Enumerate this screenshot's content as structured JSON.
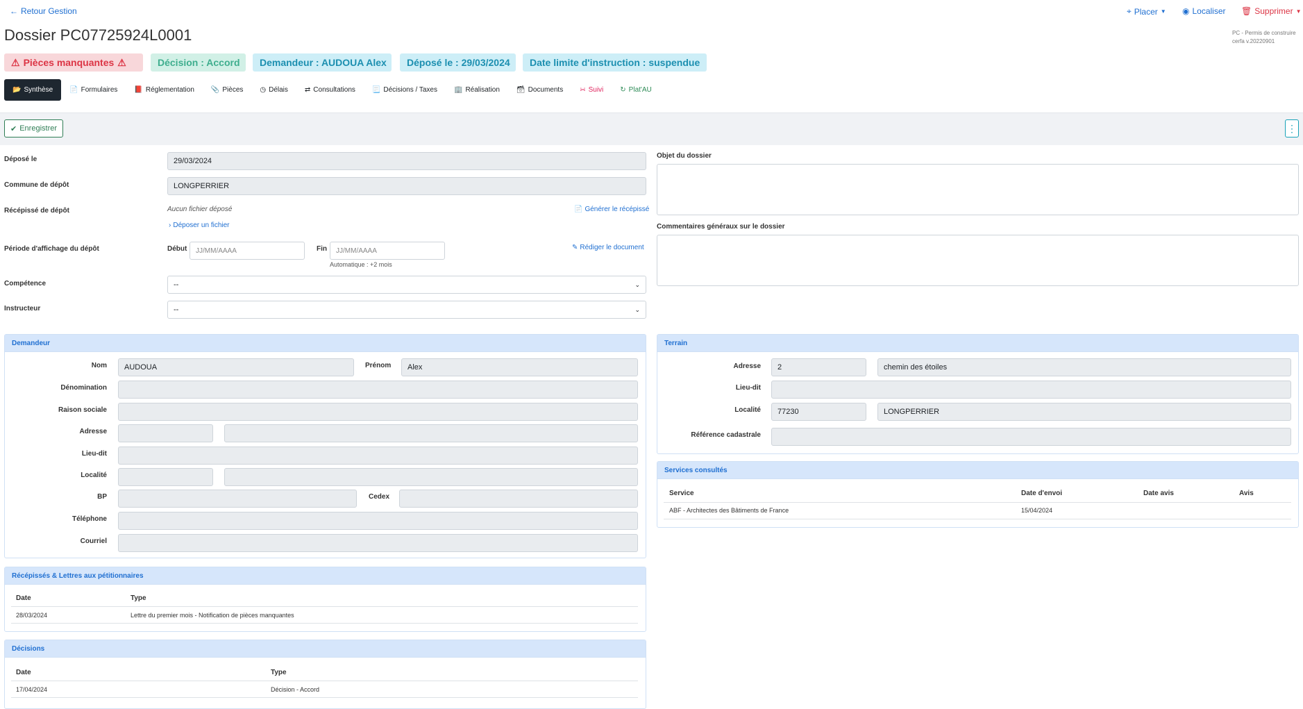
{
  "nav": {
    "back_label": "Retour Gestion",
    "placer_label": "Placer",
    "localiser_label": "Localiser",
    "supprimer_label": "Supprimer"
  },
  "header": {
    "title": "Dossier PC07725924L0001",
    "cerfa_line1": "PC - Permis de construire",
    "cerfa_line2": "cerfa v.20220901"
  },
  "badges": {
    "pieces": "Pièces manquantes",
    "decision": "Décision : Accord",
    "demandeur": "Demandeur : AUDOUA Alex",
    "depose": "Déposé le : 29/03/2024",
    "limite": "Date limite d'instruction : suspendue"
  },
  "tabs": [
    {
      "label": "Synthèse"
    },
    {
      "label": "Formulaires"
    },
    {
      "label": "Réglementation"
    },
    {
      "label": "Pièces"
    },
    {
      "label": "Délais"
    },
    {
      "label": "Consultations"
    },
    {
      "label": "Décisions / Taxes"
    },
    {
      "label": "Réalisation"
    },
    {
      "label": "Documents"
    },
    {
      "label": "Suivi"
    },
    {
      "label": "Plat'AU"
    }
  ],
  "toolbar": {
    "save_label": "Enregistrer"
  },
  "form": {
    "depose_label": "Déposé le",
    "depose_value": "29/03/2024",
    "commune_label": "Commune de dépôt",
    "commune_value": "LONGPERRIER",
    "recepisse_label": "Récépissé de dépôt",
    "no_file": "Aucun fichier déposé",
    "generer_link": "Générer le récépissé",
    "deposer_link": "Déposer un fichier",
    "periode_label": "Période d'affichage du dépôt",
    "debut_label": "Début",
    "fin_label": "Fin",
    "date_placeholder": "JJ/MM/AAAA",
    "auto_note": "Automatique : +2 mois",
    "rediger_link": "Rédiger le document",
    "competence_label": "Compétence",
    "competence_value": "--",
    "instructeur_label": "Instructeur",
    "instructeur_value": "--",
    "objet_label": "Objet du dossier",
    "commentaires_label": "Commentaires généraux sur le dossier"
  },
  "demandeur": {
    "title": "Demandeur",
    "nom_label": "Nom",
    "nom_value": "AUDOUA",
    "prenom_label": "Prénom",
    "prenom_value": "Alex",
    "denomination_label": "Dénomination",
    "raison_label": "Raison sociale",
    "adresse_label": "Adresse",
    "lieudit_label": "Lieu-dit",
    "localite_label": "Localité",
    "bp_label": "BP",
    "cedex_label": "Cedex",
    "telephone_label": "Téléphone",
    "courriel_label": "Courriel"
  },
  "terrain": {
    "title": "Terrain",
    "adresse_label": "Adresse",
    "numero": "2",
    "voie": "chemin des étoiles",
    "lieudit_label": "Lieu-dit",
    "localite_label": "Localité",
    "cp": "77230",
    "ville": "LONGPERRIER",
    "cadastre_label": "Référence cadastrale"
  },
  "services": {
    "title": "Services consultés",
    "headers": [
      "Service",
      "Date d'envoi",
      "Date avis",
      "Avis"
    ],
    "rows": [
      {
        "service": "ABF - Architectes des Bâtiments de France",
        "envoi": "15/04/2024",
        "date_avis": "",
        "avis": ""
      }
    ]
  },
  "recepisses": {
    "title": "Récépissés & Lettres aux pétitionnaires",
    "headers": [
      "Date",
      "Type"
    ],
    "rows": [
      {
        "date": "28/03/2024",
        "type": "Lettre du premier mois - Notification de pièces manquantes"
      }
    ]
  },
  "decisions": {
    "title": "Décisions",
    "headers": [
      "Date",
      "Type"
    ],
    "rows": [
      {
        "date": "17/04/2024",
        "type": "Décision - Accord"
      }
    ]
  },
  "colors": {
    "primary": "#1f6fd1",
    "danger": "#dc3545",
    "success": "#2e7d54",
    "active_tab": "#1e2730"
  }
}
